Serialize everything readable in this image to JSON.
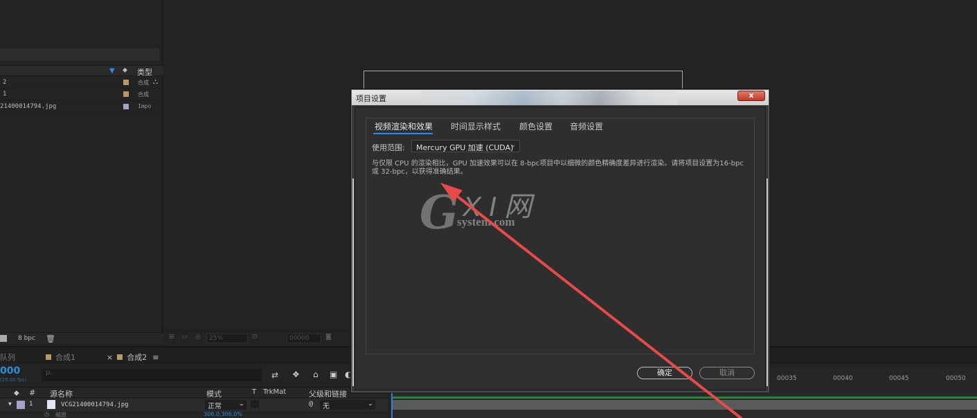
{
  "project_panel": {
    "header_type_label": "类型",
    "rows": [
      {
        "name": "2",
        "type": "合成",
        "color": "#b59a68"
      },
      {
        "name": "1",
        "type": "合成",
        "color": "#b59a68"
      },
      {
        "name": "21400014794.jpg",
        "type": "Impo",
        "color": "#a8a0c8"
      }
    ],
    "footer_bpc": "8 bpc"
  },
  "viewer_toolbar": {
    "zoom": "25%",
    "timecode": "00000"
  },
  "timeline": {
    "tabs": [
      "队列",
      "合成1",
      "合成2"
    ],
    "current_time": "000",
    "fps": "(25.00 fps)",
    "search_placeholder": "ρ.",
    "columns": {
      "num": "#",
      "source_name": "源名称",
      "mode": "模式",
      "t": "T",
      "trkmat": "TrkMat",
      "parent": "父级和链接"
    },
    "layer": {
      "index": "1",
      "name": "VCG21400014794.jpg",
      "mode": "正常",
      "parent": "无"
    },
    "sub_row": "缩放",
    "sub_value": "306.0,306.0%",
    "ruler_ticks": [
      "00035",
      "00040",
      "00045",
      "00050"
    ]
  },
  "dialog": {
    "title": "项目设置",
    "close": "x",
    "tabs": [
      "视频渲染和效果",
      "时间显示样式",
      "颜色设置",
      "音频设置"
    ],
    "active_tab": 0,
    "scope_label": "使用范围:",
    "scope_value": "Mercury GPU 加速 (CUDA)",
    "description": "与仅限 CPU 的渲染相比，GPU 加速效果可以在 8-bpc项目中以细微的颜色精确度差异进行渲染。请将项目设置为16-bpc或 32-bpc，以获得准确结果。",
    "ok_label": "确定",
    "cancel_label": "取消"
  },
  "watermark": {
    "g": "G",
    "xi": "X I 网",
    "system": "system.com"
  },
  "colors": {
    "accent_blue": "#2d8ceb",
    "arrow_red": "#e84a4a",
    "timeline_green": "#1c8a2e"
  }
}
